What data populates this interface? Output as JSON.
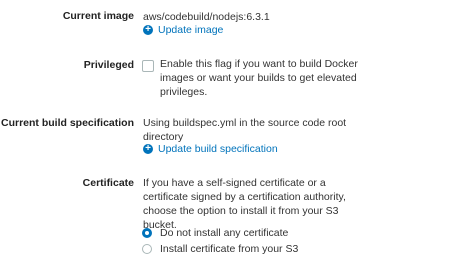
{
  "fields": {
    "current_image": {
      "label": "Current image",
      "value": "aws/codebuild/nodejs:6.3.1",
      "link": "Update image"
    },
    "privileged": {
      "label": "Privileged",
      "description_lines": [
        "Enable this flag if you want to build Docker",
        "images or want your builds to get elevated",
        "privileges."
      ]
    },
    "build_spec": {
      "label": "Current build specification",
      "value_lines": [
        "Using buildspec.yml in the source code root",
        "directory"
      ],
      "link": "Update build specification"
    },
    "certificate": {
      "label": "Certificate",
      "description_lines": [
        "If you have a self-signed certificate or a",
        "certificate signed by a certification authority,",
        "choose the option to install it from your S3",
        "bucket."
      ],
      "options": [
        "Do not install any certificate",
        "Install certificate from your S3"
      ]
    }
  },
  "icons": {
    "update_link": "plus-circle-icon"
  },
  "colors": {
    "link": "#0073bb",
    "radio_selected": "#0073bb"
  }
}
